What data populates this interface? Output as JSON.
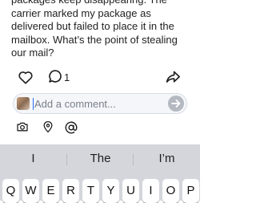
{
  "post": {
    "text": "packages keep disappearing. The carrier marked my package as delivered but failed to place it in the mailbox. What’s the point of stealing our mail?"
  },
  "actions": {
    "like_icon": "heart-outline-icon",
    "reply_icon": "speech-bubble-icon",
    "reply_count": "1",
    "share_icon": "share-arrow-icon"
  },
  "comment": {
    "placeholder": "Add a comment...",
    "value": "",
    "send_icon": "arrow-right-icon"
  },
  "attachments": {
    "camera_icon": "camera-icon",
    "location_icon": "location-pin-icon",
    "mention_icon": "at-sign-icon"
  },
  "keyboard": {
    "suggestions": [
      "I",
      "The",
      "I’m"
    ],
    "keys": [
      "Q",
      "W",
      "E",
      "R",
      "T",
      "Y",
      "U",
      "I",
      "O",
      "P"
    ]
  },
  "colors": {
    "cursor": "#2f6df6",
    "send_button": "#b4b8c0",
    "keyboard_background": "#d4d6dc"
  }
}
